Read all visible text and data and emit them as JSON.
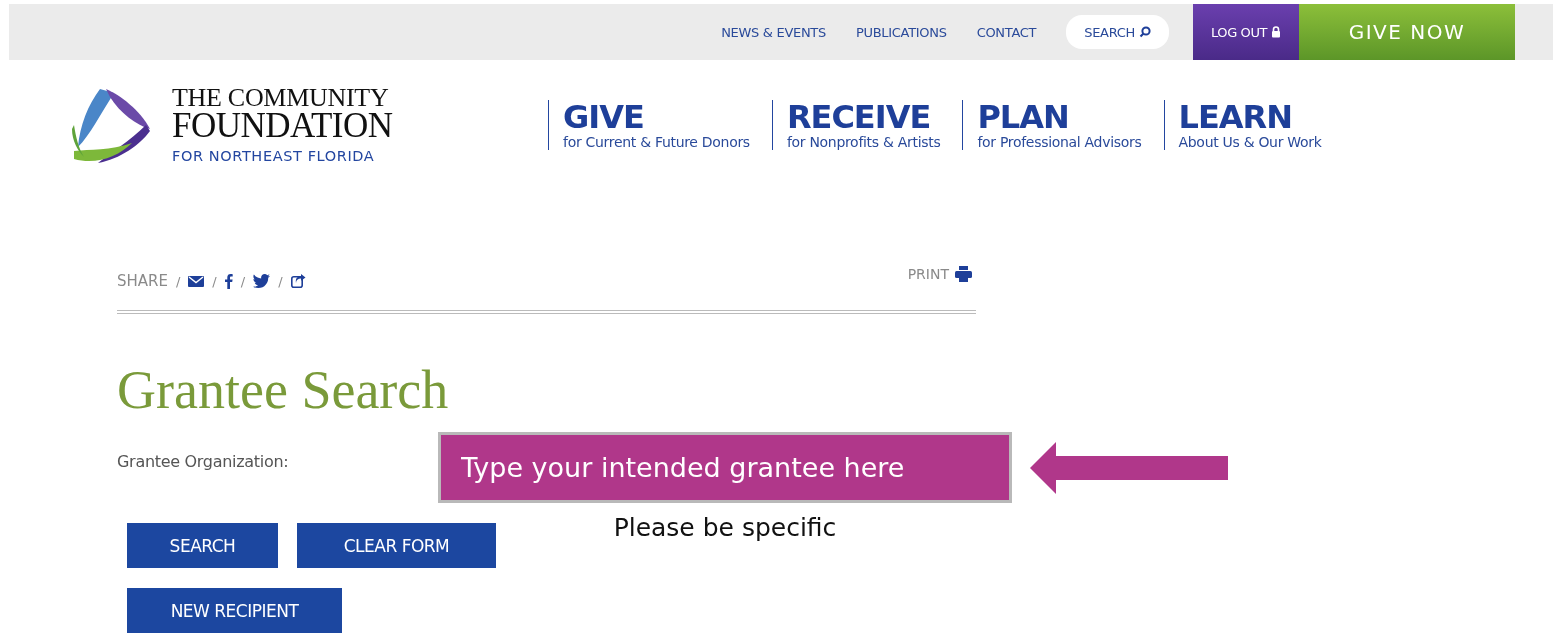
{
  "top_bar": {
    "links": [
      "NEWS & EVENTS",
      "PUBLICATIONS",
      "CONTACT"
    ],
    "search": {
      "label": "SEARCH"
    },
    "logout": {
      "label": "LOG OUT"
    },
    "give_now": {
      "label": "GIVE NOW"
    }
  },
  "logo": {
    "line_1": "THE COMMUNITY",
    "line_2": "FOUNDATION",
    "line_3": "FOR NORTHEAST FLORIDA"
  },
  "main_nav": [
    {
      "title": "GIVE",
      "subtitle": "for Current & Future Donors"
    },
    {
      "title": "RECEIVE",
      "subtitle": "for Nonprofits & Artists"
    },
    {
      "title": "PLAN",
      "subtitle": "for Professional Advisors"
    },
    {
      "title": "LEARN",
      "subtitle": "About Us & Our Work"
    }
  ],
  "share": {
    "label": "SHARE",
    "separators": [
      "/",
      "/",
      "/",
      "/"
    ],
    "print": "PRINT"
  },
  "page_title": "Grantee Search",
  "form": {
    "label": "Grantee Organization:",
    "value": "Type your intended grantee here",
    "note": "Please be specific"
  },
  "buttons": [
    "SEARCH",
    "CLEAR FORM",
    "NEW RECIPIENT"
  ]
}
